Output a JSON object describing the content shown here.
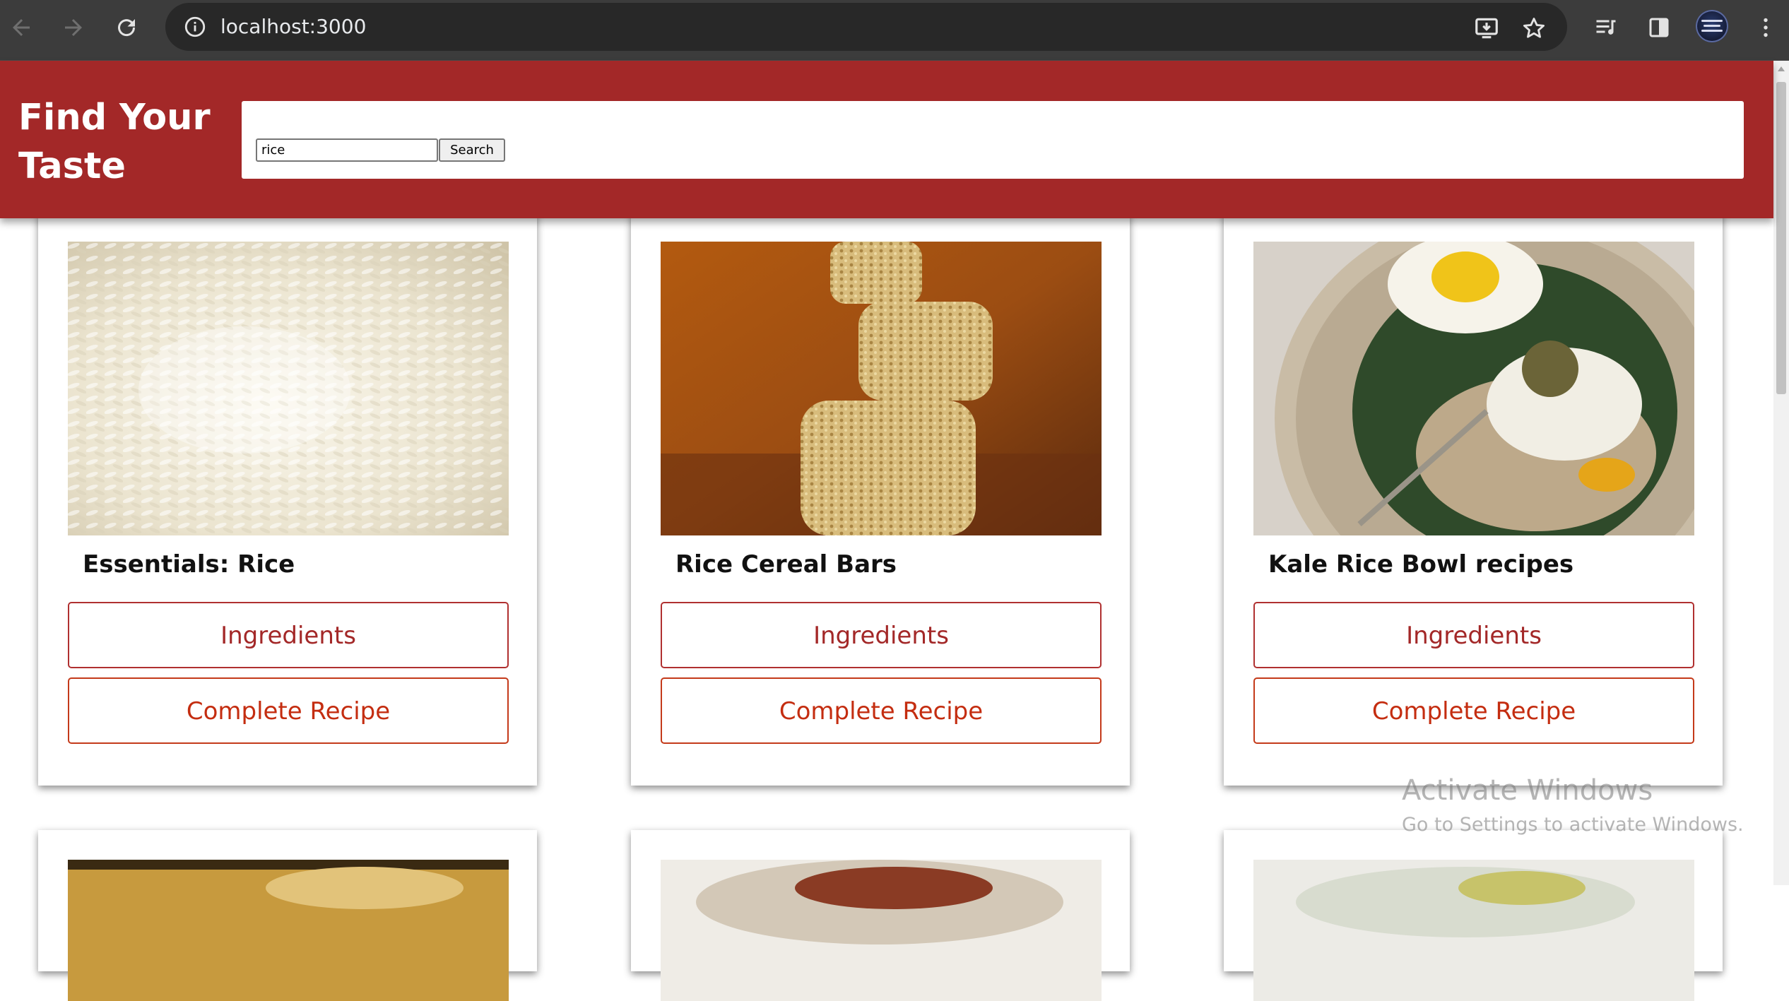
{
  "browser": {
    "url": "localhost:3000",
    "icons": {
      "back": "arrow-left-icon",
      "forward": "arrow-right-icon",
      "reload": "reload-icon",
      "site_info": "info-icon",
      "install": "install-app-icon",
      "bookmark": "star-icon",
      "media": "media-control-icon",
      "side_panel": "side-panel-icon",
      "menu": "kebab-menu-icon"
    }
  },
  "header": {
    "title": "Find Your Taste",
    "background_color": "#a32828"
  },
  "search": {
    "value": "rice",
    "button_label": "Search"
  },
  "recipes": [
    {
      "title": "Essentials: Rice",
      "ingredients_label": "Ingredients",
      "recipe_label": "Complete Recipe"
    },
    {
      "title": "Rice Cereal Bars",
      "ingredients_label": "Ingredients",
      "recipe_label": "Complete Recipe"
    },
    {
      "title": "Kale Rice Bowl recipes",
      "ingredients_label": "Ingredients",
      "recipe_label": "Complete Recipe"
    }
  ],
  "watermark": {
    "line1": "Activate Windows",
    "line2": "Go to Settings to activate Windows."
  }
}
